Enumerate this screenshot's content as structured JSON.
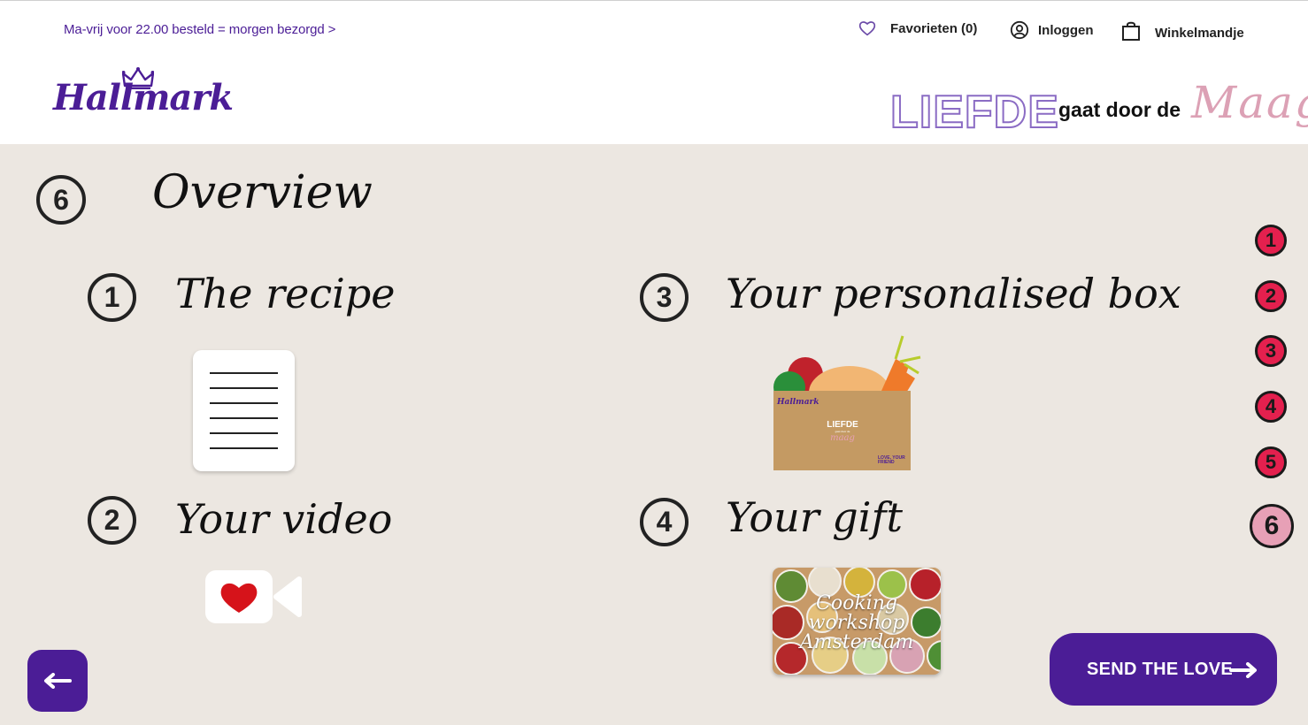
{
  "header": {
    "promo": "Ma-vrij voor 22.00 besteld = morgen bezorgd >",
    "favorites_label": "Favorieten (0)",
    "login_label": "Inloggen",
    "cart_label": "Winkelmandje",
    "logo_text": "Hallmark",
    "campaign": {
      "word1": "LIEFDE",
      "middle": "gaat door de",
      "word2": "Maag"
    }
  },
  "colors": {
    "brand": "#4b1d96",
    "background": "#ece7e1",
    "nav_dot": "#e4204e",
    "nav_dot_active": "#e7a0b6"
  },
  "overview": {
    "number": "6",
    "title": "Overview"
  },
  "sections": [
    {
      "number": "1",
      "title": "The recipe",
      "icon": "recipe-document-icon"
    },
    {
      "number": "2",
      "title": "Your video",
      "icon": "video-heart-icon"
    },
    {
      "number": "3",
      "title": "Your personalised box",
      "icon": "gift-box-illustration"
    },
    {
      "number": "4",
      "title": "Your gift",
      "icon": "gift-card-image"
    }
  ],
  "box": {
    "brand": "Hallmark",
    "word1": "LIEFDE",
    "middle": "gaat door de",
    "word2": "maag",
    "corner": "LOVE, YOUR FRIEND"
  },
  "gift_card": {
    "caption": "Cooking workshop Amsterdam"
  },
  "side_nav": {
    "steps": [
      "1",
      "2",
      "3",
      "4",
      "5",
      "6"
    ],
    "active": "6"
  },
  "buttons": {
    "back_icon": "arrow-left-icon",
    "send_label": "SEND THE LOVE",
    "send_icon": "arrow-right-icon"
  }
}
